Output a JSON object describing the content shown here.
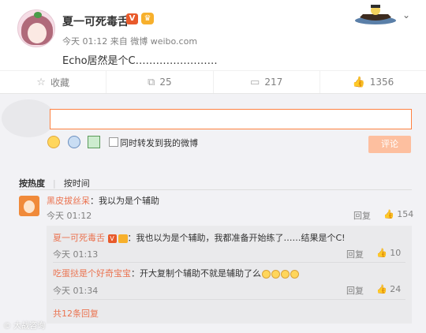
{
  "post": {
    "username": "夏一可死毒舌",
    "v_badge": "V",
    "time": "今天 01:12",
    "source_prefix": "来自",
    "source": "微博 weibo.com",
    "text": "Echo居然是个C……………………"
  },
  "actions": [
    {
      "label": "收藏",
      "icon": "star-icon"
    },
    {
      "label": "25",
      "icon": "share-icon"
    },
    {
      "label": "217",
      "icon": "comment-icon"
    },
    {
      "label": "1356",
      "icon": "like-icon"
    }
  ],
  "composer": {
    "checkbox_label": "同时转发到我的微博",
    "submit_label": "评论"
  },
  "sort": {
    "hot": "按热度",
    "time": "按时间"
  },
  "comments": [
    {
      "user": "黑皮拔丝呆",
      "text": "：我以为是个辅助",
      "time": "今天 01:12",
      "reply": "回复",
      "likes": "154"
    }
  ],
  "sub_comments": [
    {
      "user": "夏一可死毒舌",
      "text": "：我也以为是个辅助，我都准备开始练了……结果是个C!",
      "time": "今天 01:13",
      "reply": "回复",
      "likes": "10"
    },
    {
      "user": "吃蛋挞是个好奇宝宝",
      "text": "：开大复制个辅助不就是辅助了么",
      "time": "今天 01:34",
      "reply": "回复",
      "likes": "24"
    }
  ],
  "more_replies": "共12条回复",
  "watermark": "© 大战咨询"
}
